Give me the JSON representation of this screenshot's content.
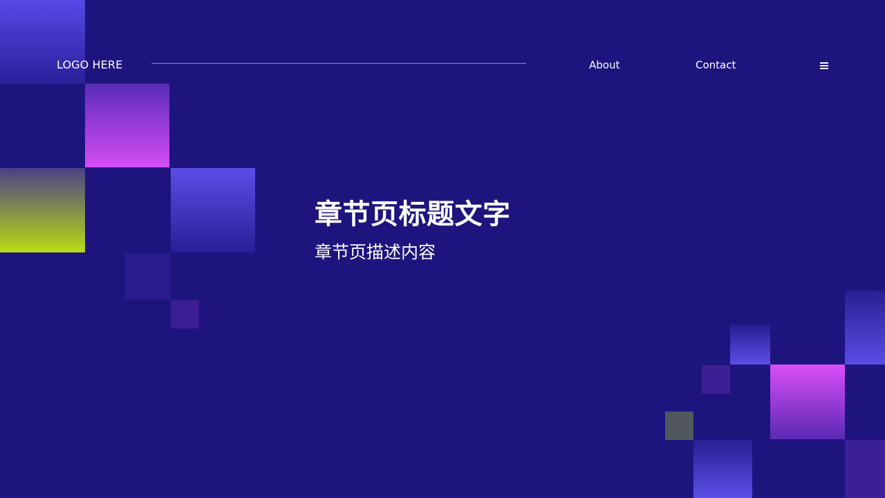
{
  "header": {
    "logo_text": "LOGO HERE",
    "nav": [
      {
        "label": "About"
      },
      {
        "label": "Contact"
      }
    ],
    "menu_icon": "hamburger-menu-icon"
  },
  "section": {
    "title": "章节页标题文字",
    "subtitle": "章节页描述内容"
  },
  "colors": {
    "background": "#1e147d",
    "accent_purple": "#d54df5",
    "accent_blue": "#5649e6",
    "accent_lime": "#b9dc14",
    "text": "#ffffff"
  }
}
